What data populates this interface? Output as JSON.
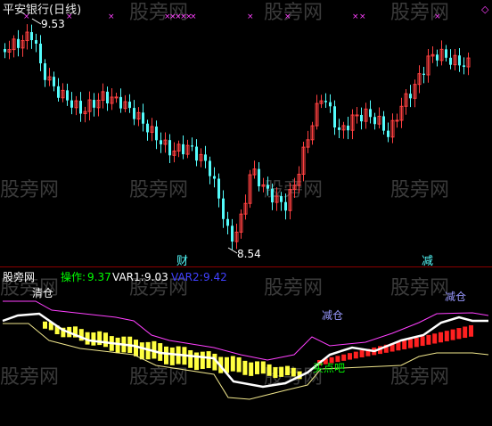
{
  "colors": {
    "background": "#000000",
    "panel_divider": "#8b0000",
    "up_candle": "#ff4040",
    "down_candle": "#54fcfc",
    "marker": "#ff40ff",
    "watermark": "#6a6a6a",
    "title_text": "#e8e8e8",
    "caozuo": "#00ff00",
    "var1": "#ffffff",
    "var2": "#4040ff",
    "upper_band": "#ff40ff",
    "lower_band": "#f0e68c",
    "main_line": "#ffffff",
    "bear_bar": "#ffff40",
    "bull_bar": "#ff2020"
  },
  "top_panel": {
    "title": "平安银行(日线)",
    "high_label": "9.53",
    "low_label": "8.54",
    "signal_cai": "财",
    "signal_jian": "减",
    "marker_glyph": "×"
  },
  "bottom_panel": {
    "indicator_name": "股旁网",
    "caozuo_label": "操作:",
    "caozuo_value": "9.37",
    "var1_label": "VAR1:",
    "var1_value": "9.03",
    "var2_label": "VAR2:",
    "var2_value": "9.42",
    "label_qingcang": "清仓",
    "label_jiancang_mid": "减仓",
    "label_jiancang_right": "减仓",
    "label_maidianba": "买点吧"
  },
  "watermark_text": "股旁网",
  "corner_glyph": "◇",
  "chart_data": {
    "type": "candlestick",
    "title": "平安银行(日线)",
    "annotations": [
      "9.53",
      "8.54",
      "财",
      "减"
    ],
    "indicator_series": [
      {
        "name": "操作",
        "last": 9.37
      },
      {
        "name": "VAR1",
        "last": 9.03
      },
      {
        "name": "VAR2",
        "last": 9.42
      }
    ]
  }
}
